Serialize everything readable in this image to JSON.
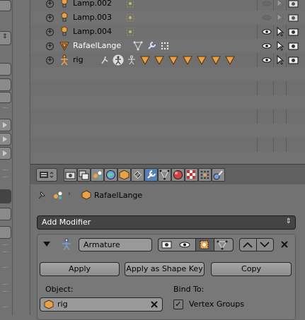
{
  "outliner": {
    "rows": [
      {
        "label": "Lamp.002"
      },
      {
        "label": "Lamp.003"
      },
      {
        "label": "Lamp.004"
      },
      {
        "label": "RafaelLange"
      },
      {
        "label": "rig"
      }
    ]
  },
  "breadcrumb": {
    "object_name": "RafaelLange"
  },
  "add_modifier": {
    "label": "Add Modifier"
  },
  "modifier": {
    "name": "Armature",
    "apply_label": "Apply",
    "apply_shape_key_label": "Apply as Shape Key",
    "copy_label": "Copy",
    "object_label": "Object:",
    "object_value": "rig",
    "bind_to_label": "Bind To:",
    "vertex_groups_label": "Vertex Groups"
  },
  "colors": {
    "accent": "#5681b4",
    "object_orange": "#e8a34a"
  }
}
